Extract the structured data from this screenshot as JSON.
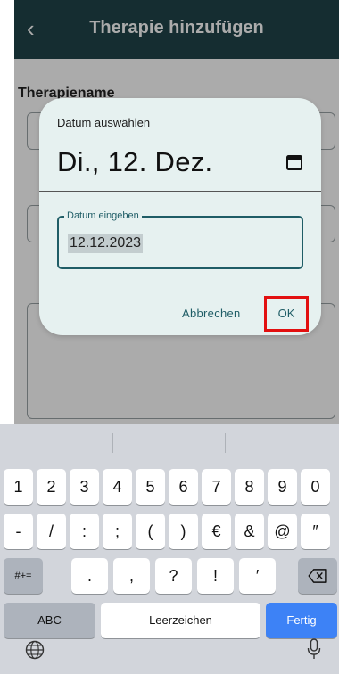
{
  "header": {
    "back_icon": "chevron-left-icon",
    "title": "Therapie hinzufügen"
  },
  "form": {
    "therapy_name_label": "Therapiename"
  },
  "dialog": {
    "title": "Datum auswählen",
    "selected_date": "Di., 12. Dez.",
    "calendar_icon": "calendar-icon",
    "input_label": "Datum eingeben",
    "input_value": "12.12.2023",
    "cancel_label": "Abbrechen",
    "ok_label": "OK",
    "accent_color": "#1f5d66",
    "highlight_color": "#e21010"
  },
  "keyboard": {
    "row1": [
      "1",
      "2",
      "3",
      "4",
      "5",
      "6",
      "7",
      "8",
      "9",
      "0"
    ],
    "row2": [
      "-",
      "/",
      ":",
      ";",
      "(",
      ")",
      "€",
      "&",
      "@",
      "″"
    ],
    "row3": [
      ".",
      ",",
      "?",
      "!",
      "′"
    ],
    "symbols_key": "#+=",
    "backspace_icon": "backspace-icon",
    "abc_key": "ABC",
    "space_key": "Leerzeichen",
    "done_key": "Fertig",
    "globe_icon": "globe-icon",
    "mic_icon": "microphone-icon"
  }
}
